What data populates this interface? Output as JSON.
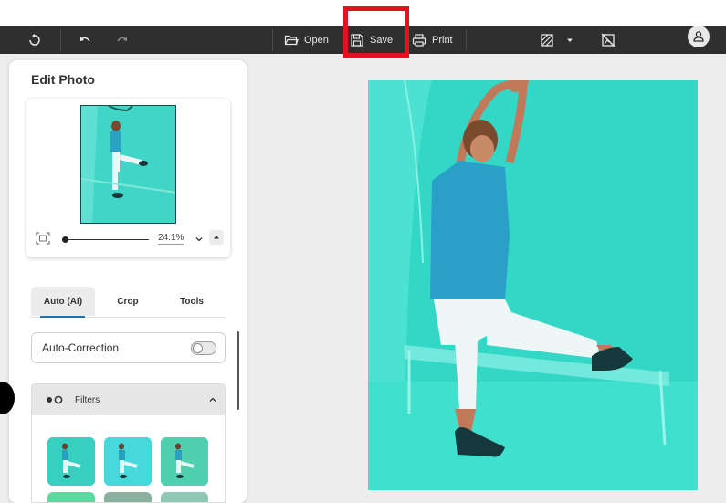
{
  "toolbar": {
    "open_label": "Open",
    "save_label": "Save",
    "print_label": "Print"
  },
  "panel": {
    "title": "Edit Photo",
    "zoom_value": "24.1%",
    "tabs": [
      {
        "label": "Auto (AI)"
      },
      {
        "label": "Crop"
      },
      {
        "label": "Tools"
      }
    ],
    "auto_correction_label": "Auto-Correction",
    "filters_label": "Filters"
  },
  "colors": {
    "accent": "#1a73b8",
    "highlight": "#e0141e",
    "toolbar_bg": "#2f2f2f",
    "photo_tint": "#32d7c5"
  }
}
